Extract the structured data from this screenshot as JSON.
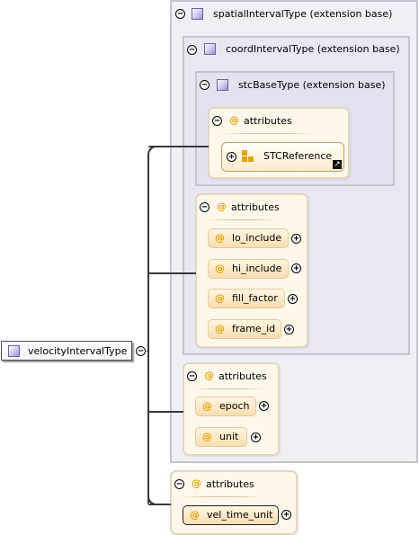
{
  "root": {
    "label": "velocityIntervalType",
    "icon": "complex-type-icon",
    "toggle": "−"
  },
  "extensions": [
    {
      "label": "spatialIntervalType (extension base)",
      "icon": "complex-type-icon",
      "toggle": "−"
    },
    {
      "label": "coordIntervalType (extension base)",
      "icon": "complex-type-icon",
      "toggle": "−"
    },
    {
      "label": "stcBaseType (extension base)",
      "icon": "complex-type-icon",
      "toggle": "−"
    }
  ],
  "groups": [
    {
      "label": "attributes",
      "toggle": "−",
      "items": [
        {
          "label": "STCReference",
          "kind": "attribute-group-reference",
          "toggle": "+",
          "link_icon": "shortcut-arrow-icon"
        }
      ]
    },
    {
      "label": "attributes",
      "toggle": "−",
      "items": [
        {
          "label": "lo_include",
          "required": false,
          "toggle": "+"
        },
        {
          "label": "hi_include",
          "required": false,
          "toggle": "+"
        },
        {
          "label": "fill_factor",
          "required": false,
          "toggle": "+"
        },
        {
          "label": "frame_id",
          "required": false,
          "toggle": "+"
        }
      ]
    },
    {
      "label": "attributes",
      "toggle": "−",
      "items": [
        {
          "label": "epoch",
          "required": false,
          "toggle": "+"
        },
        {
          "label": "unit",
          "required": false,
          "toggle": "+"
        }
      ]
    },
    {
      "label": "attributes",
      "toggle": "−",
      "items": [
        {
          "label": "vel_time_unit",
          "required": true,
          "toggle": "+"
        }
      ]
    }
  ],
  "symbols": {
    "attribute_marker": "@"
  },
  "colors": {
    "extension_border": "#c5c5d1",
    "extension_fill": "#efeff6",
    "attributes_border": "#e1d7c2",
    "attributes_fill": "#fdf8ea",
    "attribute_marker": "#e8a200",
    "attribute_group_icon": "#e8a200"
  }
}
